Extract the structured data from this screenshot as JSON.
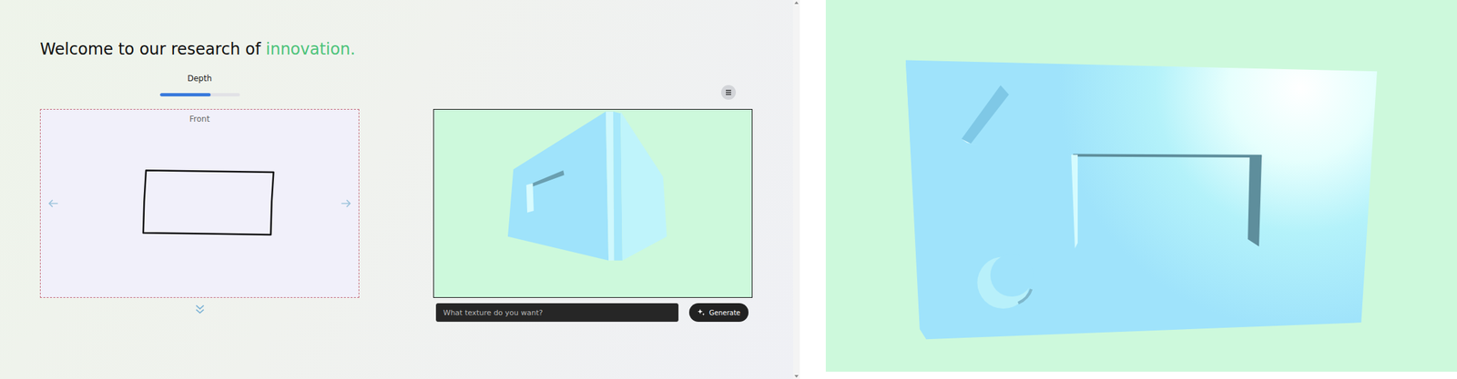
{
  "page": {
    "title": {
      "text": "Welcome to our research of ",
      "highlight": "innovation."
    }
  },
  "depth_slider": {
    "label": "Depth",
    "level": 0.64
  },
  "sketch_panel": {
    "view_label": "Front"
  },
  "texture_prompt": {
    "placeholder": "What texture do you want?"
  },
  "generate_button": {
    "label": "Generate"
  }
}
